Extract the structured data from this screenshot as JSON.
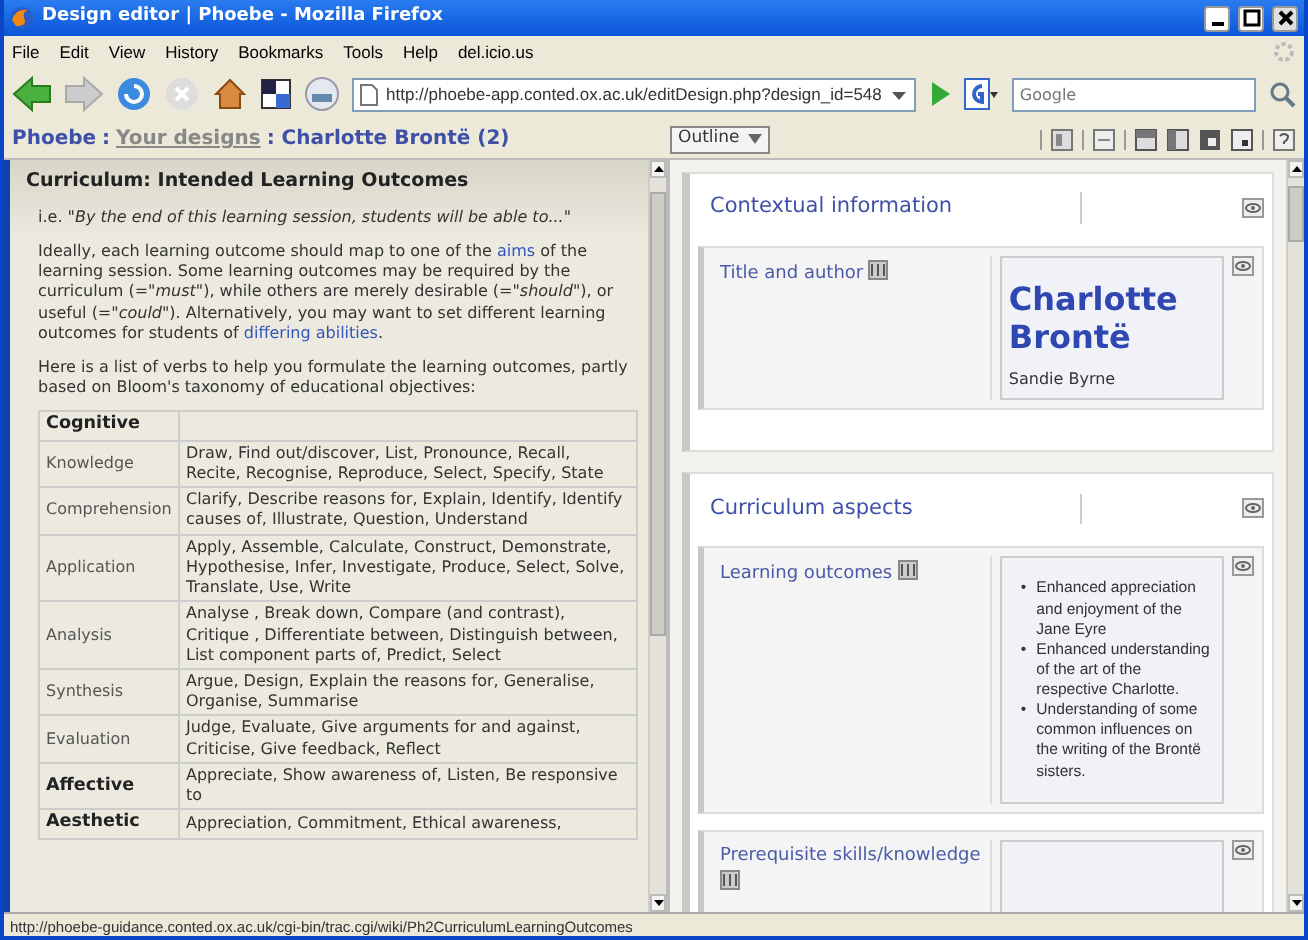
{
  "window": {
    "title": "Design editor | Phoebe - Mozilla Firefox"
  },
  "menu": [
    "File",
    "Edit",
    "View",
    "History",
    "Bookmarks",
    "Tools",
    "Help",
    "del.icio.us"
  ],
  "toolbar": {
    "url": "http://phoebe-app.conted.ox.ac.uk/editDesign.php?design_id=548",
    "search_placeholder": "Google"
  },
  "breadcrumb": {
    "home": "Phoebe",
    "separator": ":",
    "link": "Your designs",
    "current": ": Charlotte Brontë (2)"
  },
  "view_select": "Outline",
  "guidance": {
    "heading": "Curriculum: Intended Learning Outcomes",
    "intro": "i.e. *\"By the end of this learning session, students will be able to...\"*",
    "paragraph": [
      {
        "kind": "text",
        "text": "Ideally, each learning outcome should map to one of the "
      },
      {
        "kind": "link",
        "text": "aims"
      },
      {
        "kind": "text",
        "text": " of the learning session. Some learning outcomes may be required by the curriculum (=\"*must*\"), while others are merely desirable (=\"*should*\"), or useful (=\"*could*\"). Alternatively, you may want to set different learning outcomes for students of "
      },
      {
        "kind": "link",
        "text": "differing abilities"
      },
      {
        "kind": "text",
        "text": "."
      }
    ],
    "verbs_intro": "Here is a list of verbs to help you formulate the learning outcomes, partly based on Bloom's taxonomy of educational objectives:",
    "table": [
      {
        "kind": "domain",
        "category": "Cognitive"
      },
      {
        "kind": "level",
        "category": "Knowledge",
        "verbs": "Draw, Find out/discover, List, Pronounce, Recall, Recite, Recognise, Reproduce, Select, Specify, State"
      },
      {
        "kind": "level",
        "category": "Comprehension",
        "verbs": "Clarify, Describe reasons for, Explain, Identify, Identify causes of, Illustrate, Question, Understand"
      },
      {
        "kind": "level",
        "category": "Application",
        "verbs": "Apply, Assemble, Calculate, Construct, Demonstrate, Hypothesise, Infer, Investigate, Produce, Select, Solve, Translate, Use, Write"
      },
      {
        "kind": "level",
        "category": "Analysis",
        "verbs": "Analyse , Break down, Compare (and contrast), Critique , Differentiate between, Distinguish between, List component parts of, Predict, Select"
      },
      {
        "kind": "level",
        "category": "Synthesis",
        "verbs": "Argue, Design, Explain the reasons for, Generalise, Organise, Summarise"
      },
      {
        "kind": "level",
        "category": "Evaluation",
        "verbs": "Judge, Evaluate, Give arguments for and against, Criticise, Give feedback, Reflect"
      },
      {
        "kind": "domain",
        "category": "Affective",
        "verbs": "Appreciate, Show awareness of, Listen, Be responsive to"
      },
      {
        "kind": "domain",
        "category": "Aesthetic",
        "verbs": "Appreciation, Commitment, Ethical awareness,"
      }
    ]
  },
  "sections": [
    {
      "title": "Contextual information",
      "items": [
        {
          "label": "Title and author",
          "content": {
            "kind": "title",
            "heading": "Charlotte Brontë",
            "author": "Sandie Byrne"
          }
        }
      ]
    },
    {
      "title": "Curriculum aspects",
      "items": [
        {
          "label": "Learning outcomes",
          "content": {
            "kind": "bullets",
            "marker": "•",
            "bullets": [
              "Enhanced appreciation and enjoyment of the Jane Eyre",
              "Enhanced understanding of the art of the respective Charlotte.",
              "Understanding of some common influences on the writing of the Brontë sisters."
            ]
          }
        },
        {
          "label": "Prerequisite skills/knowledge",
          "content": {
            "kind": "empty"
          }
        }
      ]
    }
  ],
  "status_bar": "http://phoebe-guidance.conted.ox.ac.uk/cgi-bin/trac.cgi/wiki/Ph2CurriculumLearningOutcomes"
}
